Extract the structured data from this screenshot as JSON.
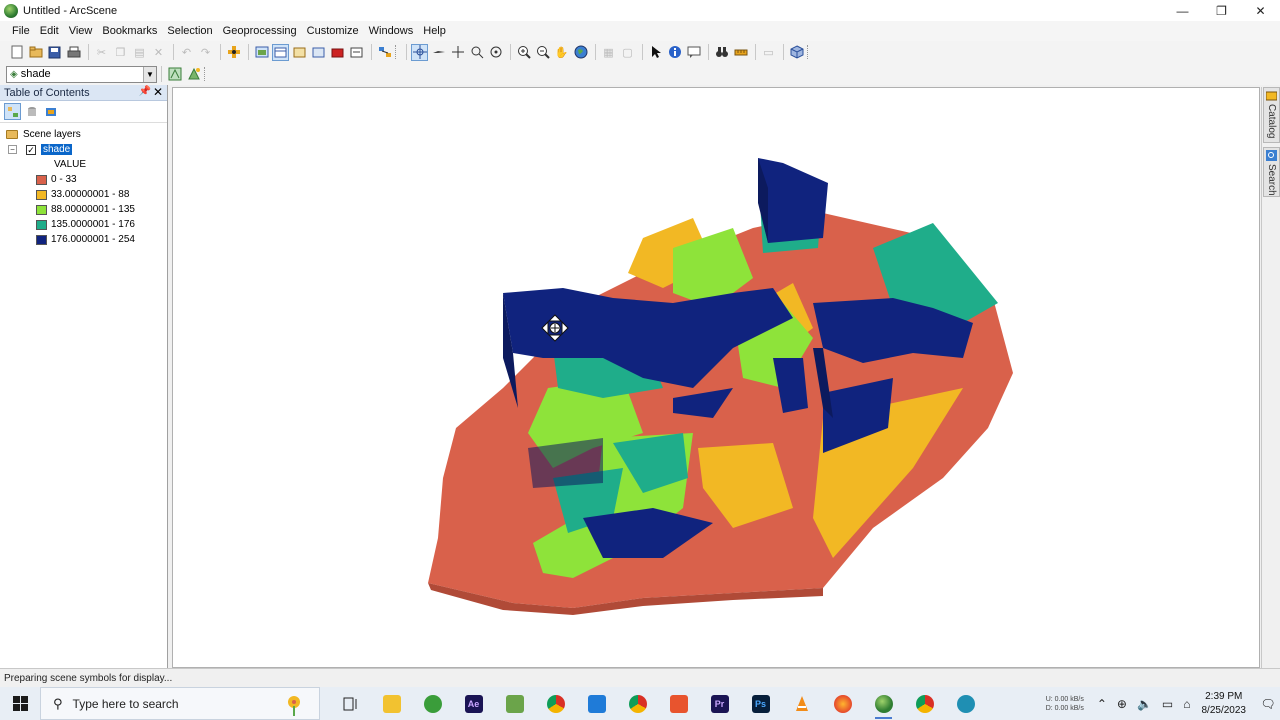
{
  "window": {
    "title": "Untitled - ArcScene",
    "minimize": "—",
    "maximize": "❐",
    "close": "✕"
  },
  "menu": [
    "File",
    "Edit",
    "View",
    "Bookmarks",
    "Selection",
    "Geoprocessing",
    "Customize",
    "Windows",
    "Help"
  ],
  "toolbar2": {
    "layer_selector": {
      "value": "shade"
    }
  },
  "toc": {
    "title": "Table of Contents",
    "root": "Scene layers",
    "layer": {
      "name": "shade",
      "checked": true,
      "field": "VALUE"
    },
    "legend": [
      {
        "label": "0 - 33",
        "color": "#d9614b"
      },
      {
        "label": "33.00000001 - 88",
        "color": "#f2b824"
      },
      {
        "label": "88.00000001 - 135",
        "color": "#8ee33a"
      },
      {
        "label": "135.0000001 - 176",
        "color": "#1fad8a"
      },
      {
        "label": "176.0000001 - 254",
        "color": "#10237e"
      }
    ]
  },
  "right_dock": {
    "catalog": "Catalog",
    "search": "Search"
  },
  "status": {
    "message": "Preparing scene symbols for display..."
  },
  "taskbar": {
    "search_placeholder": "Type here to search",
    "time": "2:39 PM",
    "date": "8/25/2023",
    "net_up": "0.00 kB/s",
    "net_down": "0.00 kB/s",
    "net_up_label": "U:",
    "net_down_label": "D:"
  }
}
